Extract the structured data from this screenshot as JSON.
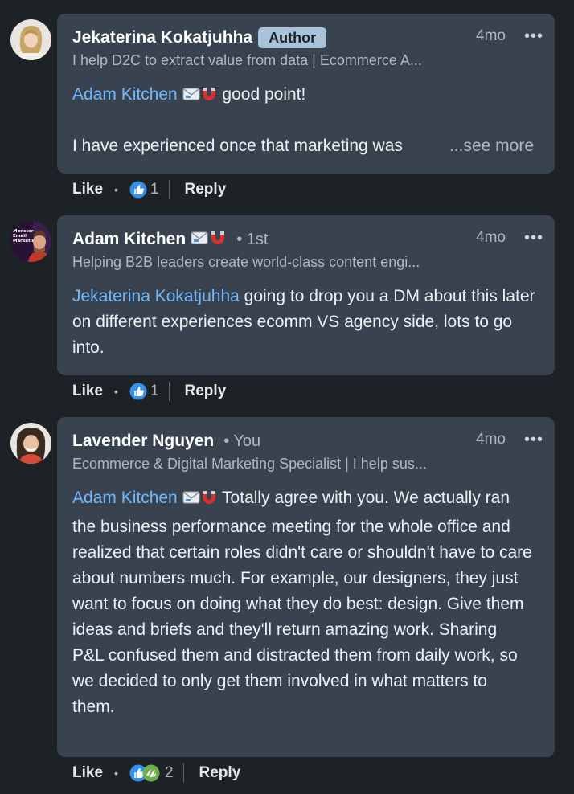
{
  "comments": [
    {
      "name": "Jekaterina Kokatjuhha",
      "badge": "Author",
      "degree": "",
      "time": "4mo",
      "headline": "I help D2C to extract value from data | Ecommerce A...",
      "mention": "Adam Kitchen",
      "text_after_mention": " good point!",
      "text_line2": "I have experienced once that marketing was",
      "see_more": "...see more",
      "like_label": "Like",
      "reaction_count": "1",
      "reply_label": "Reply"
    },
    {
      "name": "Adam Kitchen",
      "degree": "• 1st",
      "time": "4mo",
      "headline": "Helping B2B leaders create world-class content engi...",
      "mention": "Jekaterina Kokatjuhha",
      "text": " going to drop you a DM about this later on different experiences ecomm VS agency side, lots to go into.",
      "like_label": "Like",
      "reaction_count": "1",
      "reply_label": "Reply"
    },
    {
      "name": "Lavender Nguyen",
      "degree": "• You",
      "time": "4mo",
      "headline": "Ecommerce & Digital Marketing Specialist | I help sus...",
      "mention": "Adam Kitchen",
      "text": " Totally agree with you. We actually ran the business performance meeting for the whole office and realized that certain roles didn't care or shouldn't have to care about numbers much. For example, our designers, they just want to focus on doing what they do best: design. Give them ideas and briefs and they'll return amazing work. Sharing P&L confused them and distracted them from daily work, so we decided to only get them involved in what matters to them.",
      "like_label": "Like",
      "reaction_count": "2",
      "reply_label": "Reply"
    }
  ],
  "icons": {
    "more": "more-options-icon",
    "email_emoji": "envelope-emoji-icon",
    "magnet_emoji": "magnet-emoji-icon",
    "like_reaction": "like-reaction-icon",
    "support_reaction": "support-reaction-icon"
  },
  "colors": {
    "background": "#1d2226",
    "bubble": "#38434f",
    "mention": "#71b7fb",
    "badge": "#a8c2d9",
    "like_blue": "#378fe9"
  }
}
